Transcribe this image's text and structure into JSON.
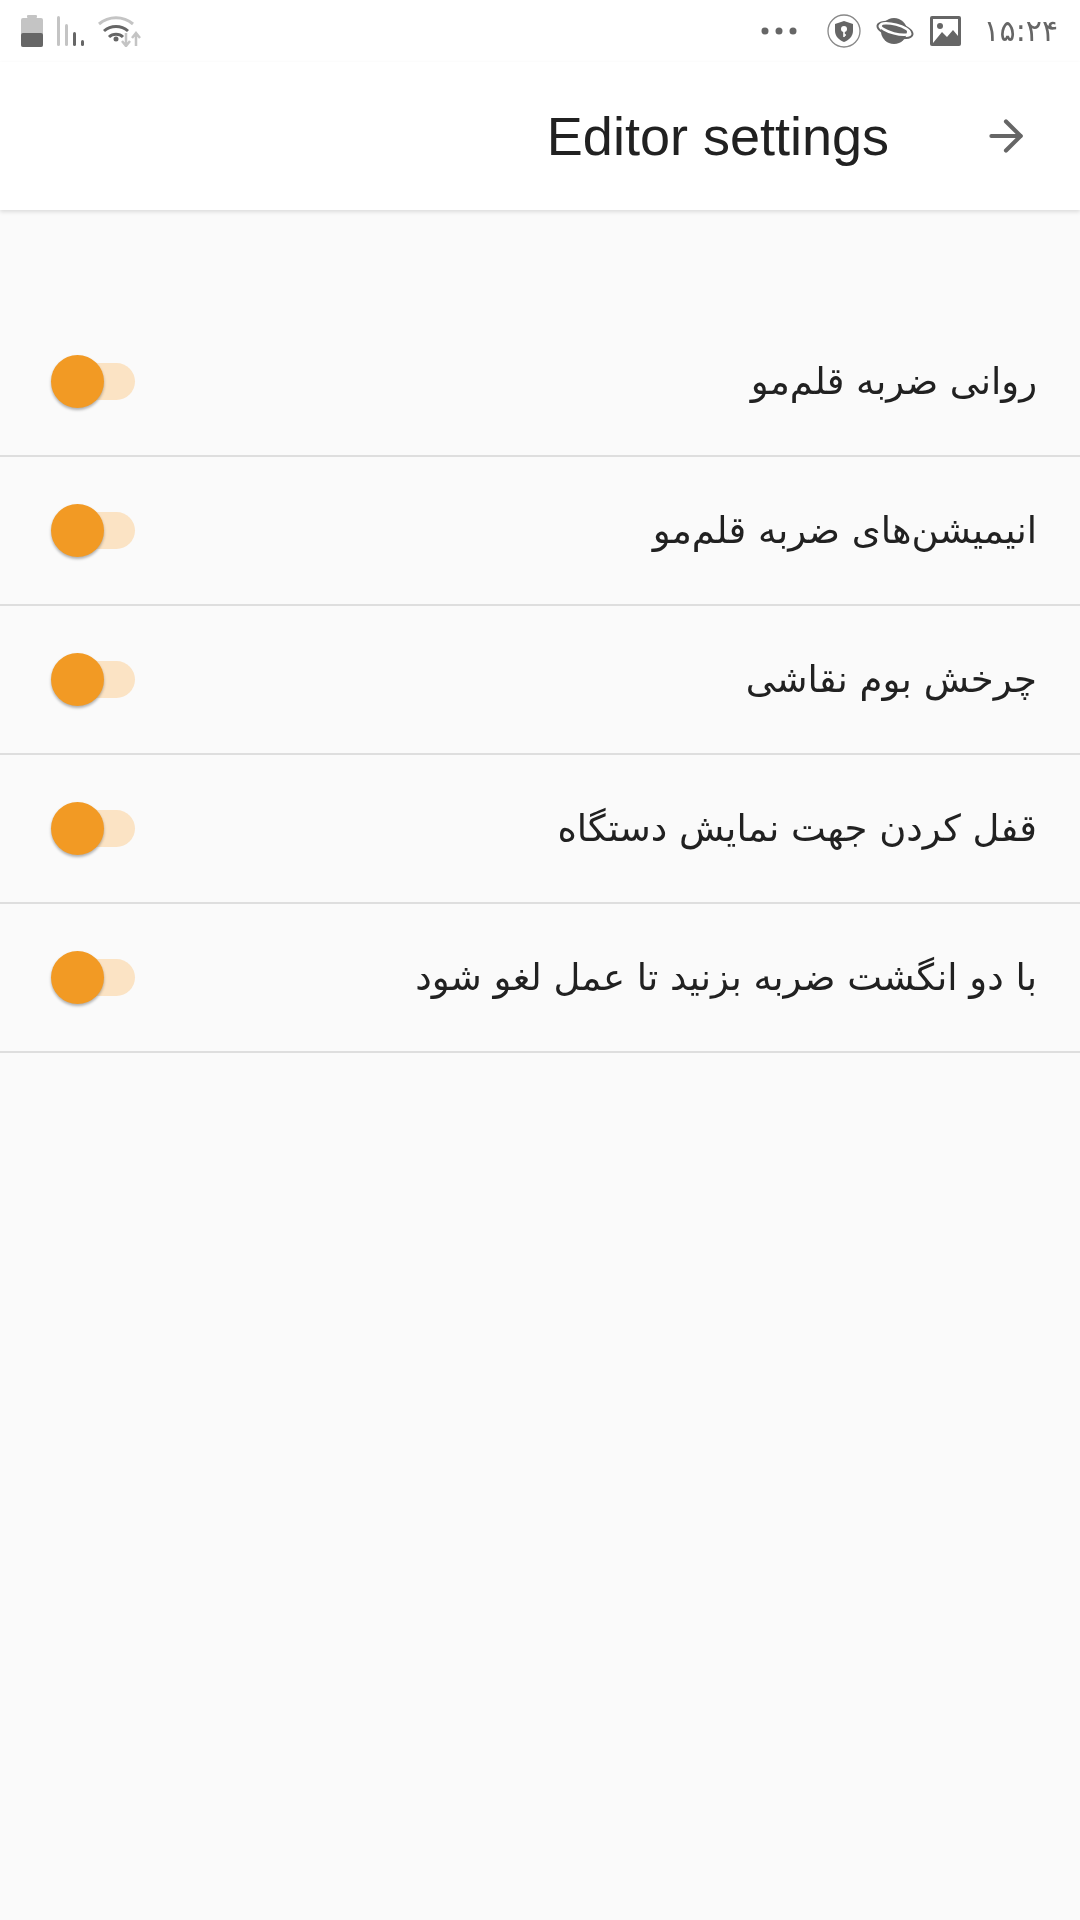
{
  "status_bar": {
    "time": "۱۵:۲۴"
  },
  "header": {
    "title": "Editor settings"
  },
  "settings": [
    {
      "label": "روانی ضربه قلم‌مو",
      "on": true
    },
    {
      "label": "انیمیشن‌های ضربه قلم‌مو",
      "on": true
    },
    {
      "label": "چرخش بوم نقاشی",
      "on": true
    },
    {
      "label": "قفل کردن جهت نمایش دستگاه",
      "on": true
    },
    {
      "label": "با دو انگشت ضربه بزنید تا عمل لغو شود",
      "on": true
    }
  ]
}
